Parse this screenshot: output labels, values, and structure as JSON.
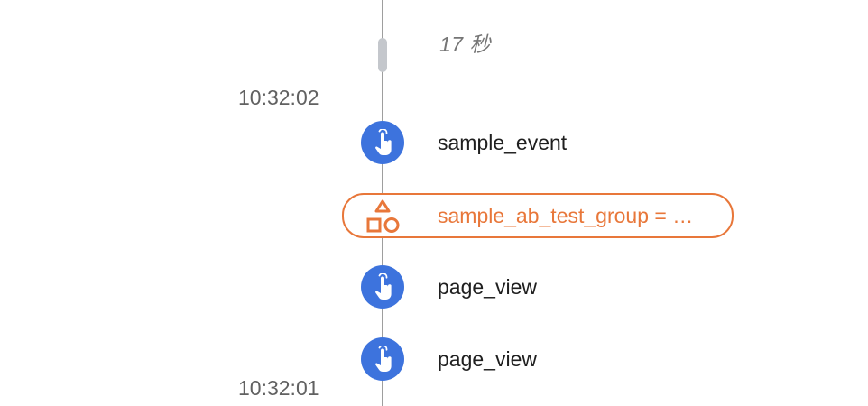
{
  "timeline": {
    "gap_duration": "17 秒",
    "timestamps": [
      "10:32:02",
      "10:32:01"
    ],
    "events": [
      {
        "label": "sample_event",
        "icon": "touch-hand-icon"
      },
      {
        "label": "page_view",
        "icon": "touch-hand-icon"
      },
      {
        "label": "page_view",
        "icon": "touch-hand-icon"
      }
    ],
    "user_property": {
      "label": "sample_ab_test_group = …",
      "icon": "shapes-icon"
    }
  },
  "colors": {
    "event_icon_bg": "#3d73dd",
    "user_property_accent": "#e8773a",
    "timeline_line": "#9e9e9e"
  }
}
